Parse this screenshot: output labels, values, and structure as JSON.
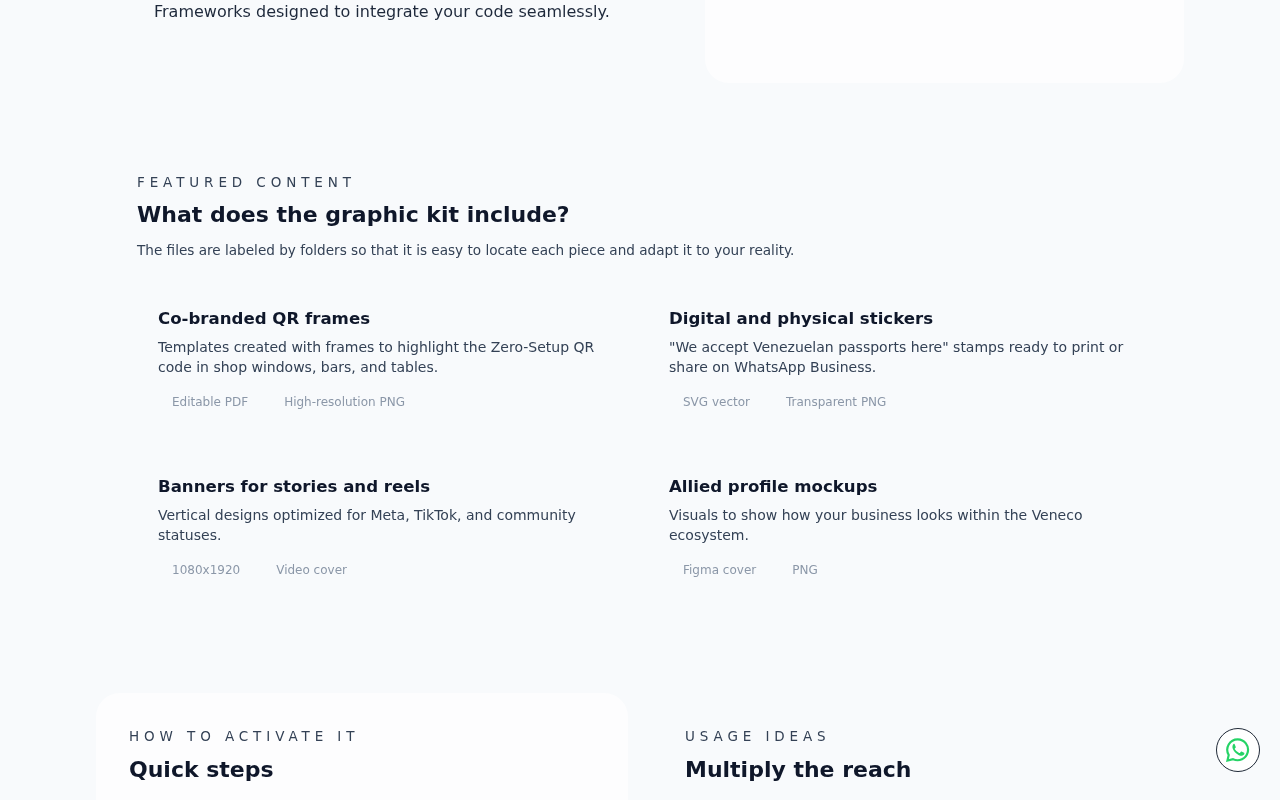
{
  "intro": {
    "text": "Frameworks designed to integrate your code seamlessly."
  },
  "featured": {
    "eyebrow": "FEATURED CONTENT",
    "title": "What does the graphic kit include?",
    "subtitle": "The files are labeled by folders so that it is easy to locate each piece and adapt it to your reality.",
    "items": [
      {
        "title": "Co-branded QR frames",
        "description": "Templates created with frames to highlight the Zero-Setup QR code in shop windows, bars, and tables.",
        "tags": [
          "Editable PDF",
          "High-resolution PNG"
        ]
      },
      {
        "title": "Digital and physical stickers",
        "description": "\"We accept Venezuelan passports here\" stamps ready to print or share on WhatsApp Business.",
        "tags": [
          "SVG vector",
          "Transparent PNG"
        ]
      },
      {
        "title": "Banners for stories and reels",
        "description": "Vertical designs optimized for Meta, TikTok, and community statuses.",
        "tags": [
          "1080x1920",
          "Video cover"
        ]
      },
      {
        "title": "Allied profile mockups",
        "description": "Visuals to show how your business looks within the Veneco ecosystem.",
        "tags": [
          "Figma cover",
          "PNG"
        ]
      }
    ]
  },
  "steps": {
    "eyebrow": "HOW TO ACTIVATE IT",
    "title": "Quick steps"
  },
  "ideas": {
    "eyebrow": "USAGE IDEAS",
    "title": "Multiply the reach"
  }
}
